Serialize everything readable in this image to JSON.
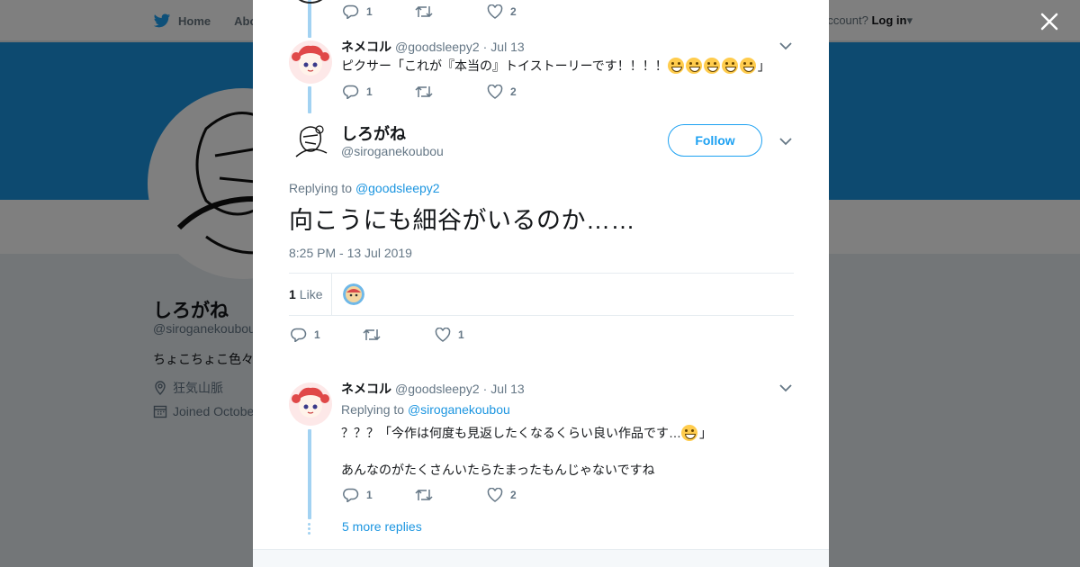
{
  "background": {
    "nav": {
      "home_label": "Home",
      "about_label": "Abo"
    },
    "login": {
      "prefix": "ccount? ",
      "label": "Log in"
    },
    "profile": {
      "name": "しろがね",
      "handle": "@siroganekoubou",
      "bio": "ちょこちょこ色々",
      "location": "狂気山脈",
      "joined": "Joined Octobe"
    }
  },
  "modal": {
    "prev_tweet_actions": {
      "replies": "1",
      "likes": "2"
    },
    "parent_tweet": {
      "fullname": "ネメコル",
      "handle": "@goodsleepy2",
      "sep": "·",
      "time": "Jul 13",
      "text": "ピクサー「これが『本当の』トイストーリーです！！！！",
      "text_end": "」",
      "emoji": [
        "grinning",
        "grinning",
        "grinning",
        "grinning",
        "laughing"
      ],
      "replies": "1",
      "likes": "2"
    },
    "main_tweet": {
      "fullname": "しろがね",
      "handle": "@siroganekoubou",
      "follow_label": "Follow",
      "replying_prefix": "Replying to ",
      "replying_to": "@goodsleepy2",
      "text": "向こうにも細谷がいるのか……",
      "timestamp": "8:25 PM - 13 Jul 2019",
      "likes_count": "1",
      "likes_label": "Like",
      "replies": "1",
      "likes": "1"
    },
    "reply_tweet": {
      "fullname": "ネメコル",
      "handle": "@goodsleepy2",
      "sep": "·",
      "time": "Jul 13",
      "replying_prefix": "Replying to ",
      "replying_to": "@siroganekoubou",
      "line1": "？？？「今作は何度も見返したくなるくらい良い作品です…",
      "line1_end": "」",
      "emoji": "blush",
      "line2": "あんなのがたくさんいたらたまったもんじゃないですね",
      "replies": "1",
      "likes": "2"
    },
    "more_replies_label": "5 more replies"
  },
  "colors": {
    "accent": "#1da1f2",
    "link": "#1b95e0",
    "thread": "#a2d2f2",
    "banner": "#1b95e0"
  }
}
